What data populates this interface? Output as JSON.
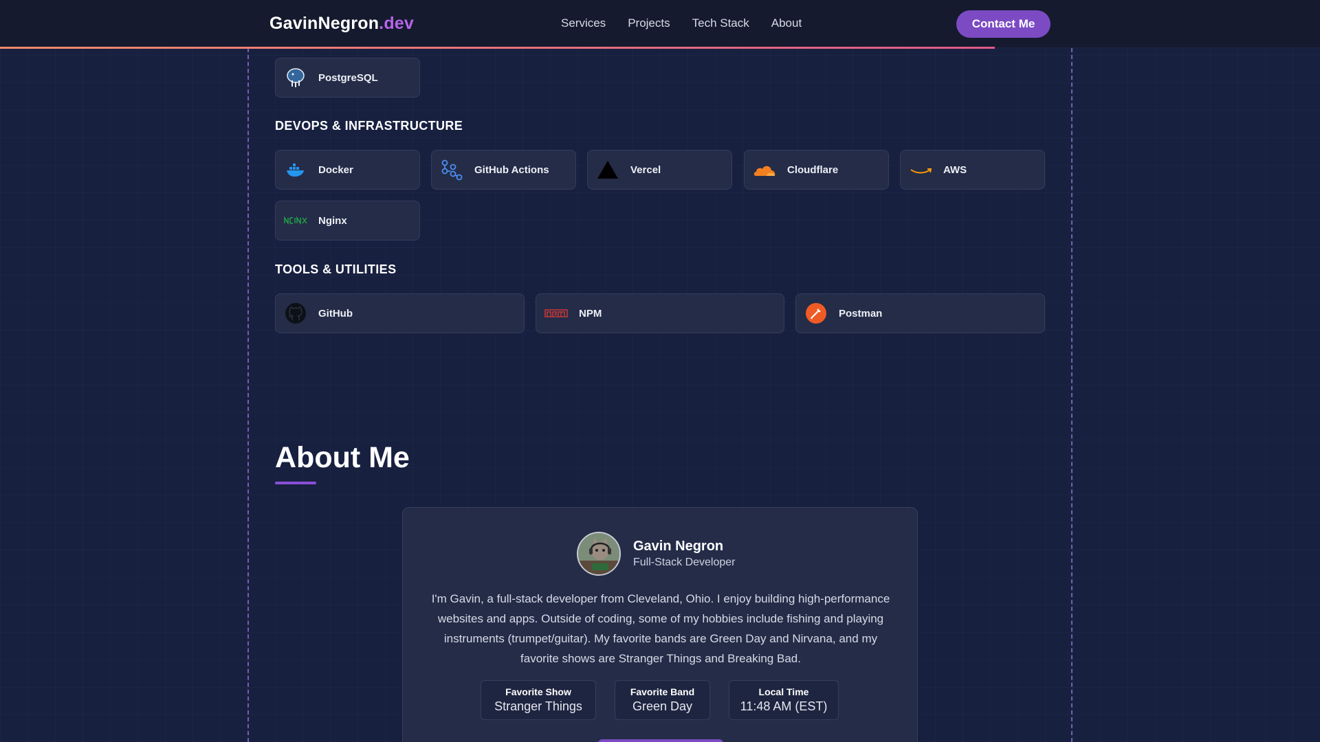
{
  "header": {
    "logo_main": "GavinNegron",
    "logo_accent": ".dev",
    "nav": [
      "Services",
      "Projects",
      "Tech Stack",
      "About"
    ],
    "contact_label": "Contact Me"
  },
  "tech": {
    "databases": [
      {
        "label": "PostgreSQL",
        "icon": "postgresql-icon"
      }
    ],
    "devops_title": "DEVOPS & INFRASTRUCTURE",
    "devops": [
      {
        "label": "Docker",
        "icon": "docker-icon"
      },
      {
        "label": "GitHub Actions",
        "icon": "github-actions-icon"
      },
      {
        "label": "Vercel",
        "icon": "vercel-icon"
      },
      {
        "label": "Cloudflare",
        "icon": "cloudflare-icon"
      },
      {
        "label": "AWS",
        "icon": "aws-icon"
      },
      {
        "label": "Nginx",
        "icon": "nginx-icon"
      }
    ],
    "tools_title": "TOOLS & UTILITIES",
    "tools": [
      {
        "label": "GitHub",
        "icon": "github-icon"
      },
      {
        "label": "NPM",
        "icon": "npm-icon"
      },
      {
        "label": "Postman",
        "icon": "postman-icon"
      }
    ]
  },
  "about": {
    "title": "About Me",
    "name": "Gavin Negron",
    "role": "Full-Stack Developer",
    "bio": "I'm Gavin, a full-stack developer from Cleveland, Ohio. I enjoy building high-performance websites and apps. Outside of coding, some of my hobbies include fishing and playing instruments (trumpet/guitar). My favorite bands are Green Day and Nirvana, and my favorite shows are Stranger Things and Breaking Bad.",
    "stats": [
      {
        "key": "Favorite Show",
        "value": "Stranger Things"
      },
      {
        "key": "Favorite Band",
        "value": "Green Day"
      },
      {
        "key": "Local Time",
        "value": "11:48 AM (EST)"
      }
    ]
  },
  "colors": {
    "background": "#182040",
    "card": "#242c48",
    "accent": "#7c4bc4",
    "logo_accent": "#b565e6"
  }
}
